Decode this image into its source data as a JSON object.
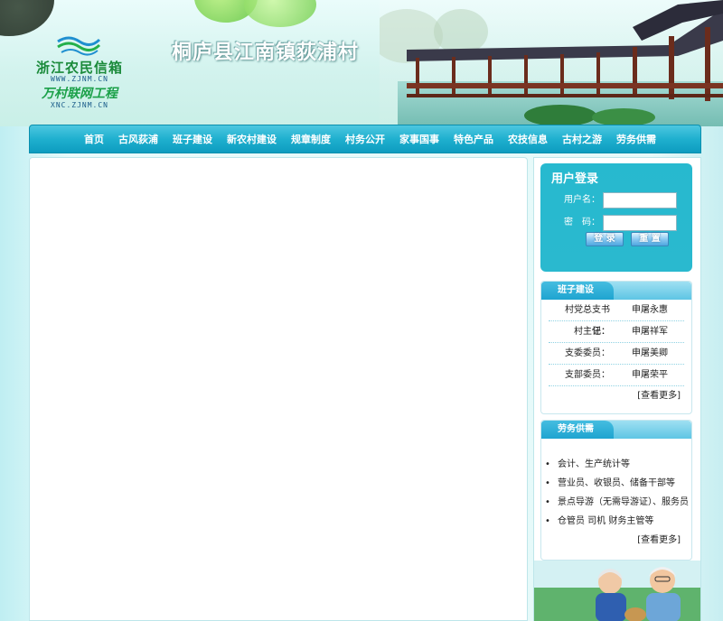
{
  "header": {
    "logo": {
      "name_line1": "浙江农民信箱",
      "url_line1": "WWW.ZJNM.CN",
      "name_line2": "万村联网工程",
      "url_line2": "XNC.ZJNM.CN"
    },
    "site_title": "桐庐县江南镇荻浦村"
  },
  "nav": {
    "items": [
      "首页",
      "古风荻浦",
      "班子建设",
      "新农村建设",
      "规章制度",
      "村务公开",
      "家事国事",
      "特色产品",
      "农技信息",
      "古村之游",
      "劳务供需"
    ]
  },
  "login": {
    "title": "用户登录",
    "username_label": "用户名：",
    "username_value": "",
    "password_label": "密　码：",
    "password_value": "",
    "login_button": "登 录",
    "reset_button": "重 置"
  },
  "committee": {
    "title": "班子建设",
    "rows": [
      {
        "role": "村党总支书记：",
        "name": "申屠永惠"
      },
      {
        "role": "村主任：",
        "name": "申屠祥军"
      },
      {
        "role": "支委委员：",
        "name": "申屠美卿"
      },
      {
        "role": "支部委员：",
        "name": "申屠荣平"
      }
    ],
    "more": "[查看更多]"
  },
  "jobs": {
    "title": "劳务供需",
    "items": [
      "会计、生产统计等",
      "营业员、收银员、储备干部等",
      "景点导游（无需导游证）、服务员",
      "仓管员  司机  财务主管等"
    ],
    "more": "[查看更多]"
  },
  "colors": {
    "nav_bg": "#1fb0cf",
    "login_bg": "#2ab9cf",
    "section_header": "#45bde0",
    "page_bg": "#e6f9f9"
  }
}
